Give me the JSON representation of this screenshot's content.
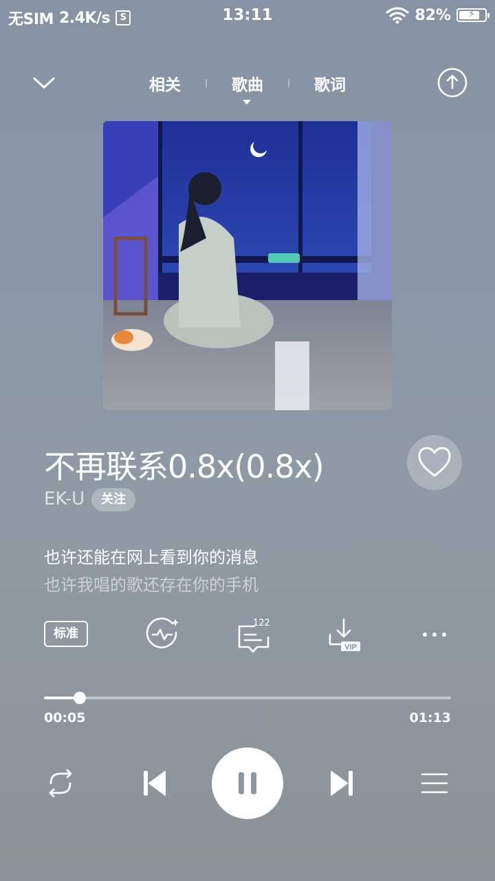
{
  "status": {
    "sim": "无SIM",
    "speed": "2.4K/s",
    "s_icon": "S",
    "time": "13:11",
    "battery_pct": "82%",
    "battery_level": 0.82
  },
  "nav": {
    "tabs": [
      {
        "label": "相关"
      },
      {
        "label": "歌曲"
      },
      {
        "label": "歌词"
      }
    ],
    "active_tab": "歌曲"
  },
  "song": {
    "title": "不再联系0.8x(0.8x)",
    "artist": "EK-U",
    "follow_label": "关注"
  },
  "lyrics": {
    "current": "也许还能在网上看到你的消息",
    "next": "也许我唱的歌还存在你的手机"
  },
  "actions": {
    "quality_label": "标准",
    "comment_count": "122",
    "download_badge": "VIP"
  },
  "progress": {
    "current": "00:05",
    "total": "01:13",
    "fraction": 0.088
  },
  "icons": {
    "collapse": "chevron-down-icon",
    "share": "share-icon",
    "like": "heart-icon",
    "effect": "sound-effect-icon",
    "comment": "comment-icon",
    "download": "download-icon",
    "more": "more-icon",
    "repeat": "repeat-icon",
    "prev": "previous-icon",
    "pause": "pause-icon",
    "next": "next-icon",
    "playlist": "playlist-icon"
  }
}
